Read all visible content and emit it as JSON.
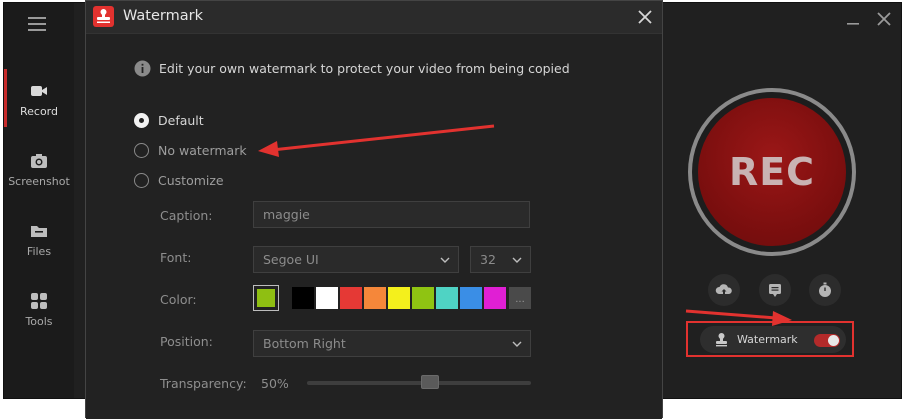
{
  "app": {
    "nav": [
      {
        "label": "Record"
      },
      {
        "label": "Screenshot"
      },
      {
        "label": "Files"
      },
      {
        "label": "Tools"
      }
    ],
    "rec_label": "REC",
    "watermark_pill_label": "Watermark",
    "watermark_toggle_on": true
  },
  "dialog": {
    "title": "Watermark",
    "info_text": "Edit your own watermark to protect your video from being copied",
    "options": [
      {
        "label": "Default",
        "checked": true
      },
      {
        "label": "No watermark",
        "checked": false
      },
      {
        "label": "Customize",
        "checked": false
      }
    ],
    "caption_label": "Caption:",
    "caption_value": "maggie",
    "font_label": "Font:",
    "font_value": "Segoe UI",
    "font_size": "32",
    "color_label": "Color:",
    "current_color": "#8fbf12",
    "palette": [
      "#000000",
      "#ffffff",
      "#e53935",
      "#f5873a",
      "#f4f01c",
      "#8fc412",
      "#4fd3c4",
      "#3a8ee6",
      "#e01fd4"
    ],
    "more_colors_label": "...",
    "position_label": "Position:",
    "position_value": "Bottom Right",
    "transparency_label": "Transparency:",
    "transparency_value": "50%"
  },
  "colors": {
    "accent": "#e2322f",
    "annotation": "#e2322f"
  }
}
